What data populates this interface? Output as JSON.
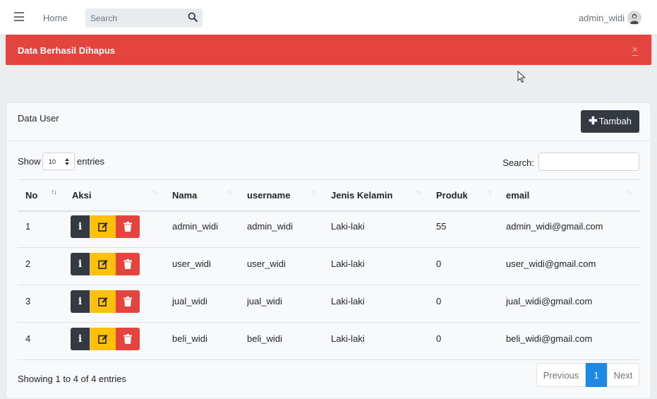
{
  "navbar": {
    "home_label": "Home",
    "search_placeholder": "Search",
    "user_name": "admin_widi"
  },
  "alert": {
    "message": "Data Berhasil Dihapus",
    "close_label": "×"
  },
  "card": {
    "title": "Data User",
    "add_button_label": "Tambah"
  },
  "table_controls": {
    "show_label": "Show",
    "page_size": "10",
    "entries_label": "entries",
    "search_label": "Search:"
  },
  "table": {
    "columns": [
      "No",
      "Aksi",
      "Nama",
      "username",
      "Jenis Kelamin",
      "Produk",
      "email"
    ],
    "rows": [
      {
        "no": "1",
        "nama": "admin_widi",
        "username": "admin_widi",
        "jenis_kelamin": "Laki-laki",
        "produk": "55",
        "email": "admin_widi@gmail.com"
      },
      {
        "no": "2",
        "nama": "user_widi",
        "username": "user_widi",
        "jenis_kelamin": "Laki-laki",
        "produk": "0",
        "email": "user_widi@gmail.com"
      },
      {
        "no": "3",
        "nama": "jual_widi",
        "username": "jual_widi",
        "jenis_kelamin": "Laki-laki",
        "produk": "0",
        "email": "jual_widi@gmail.com"
      },
      {
        "no": "4",
        "nama": "beli_widi",
        "username": "beli_widi",
        "jenis_kelamin": "Laki-laki",
        "produk": "0",
        "email": "beli_widi@gmail.com"
      }
    ]
  },
  "footer": {
    "info": "Showing 1 to 4 of 4 entries",
    "previous_label": "Previous",
    "current_page": "1",
    "next_label": "Next"
  },
  "colors": {
    "alert_bg": "#e3443d",
    "info_button": "#343a40",
    "edit_button": "#ffc107",
    "delete_button": "#e3443d",
    "active_page": "#1e88e5"
  }
}
